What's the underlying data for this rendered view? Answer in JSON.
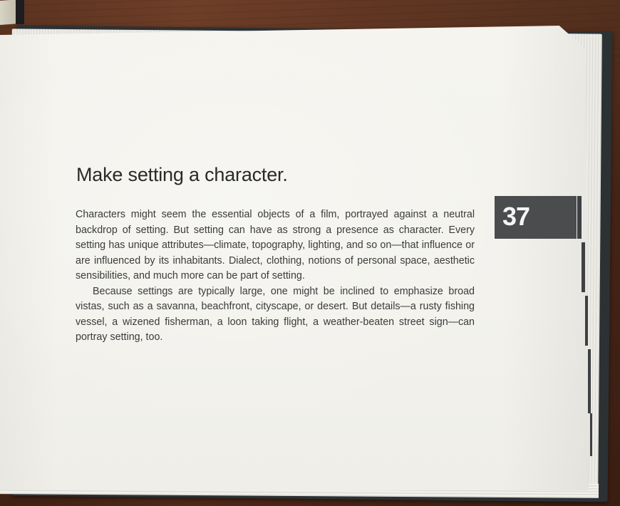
{
  "page": {
    "heading": "Make setting a character.",
    "page_number": "37",
    "paragraphs": [
      "Characters might seem the essential objects of a film, portrayed against a neutral backdrop of setting. But setting can have as strong a presence as character. Every setting has unique attributes—climate, topography, lighting, and so on—that influence or are influenced by its inhabitants. Dialect, clothing, notions of personal space, aesthetic sensibilities, and much more can be part of setting.",
      "Because settings are typically large, one might be inclined to emphasize broad vistas, such as a savanna, beachfront, cityscape, or desert. But details—a rusty fishing vessel, a wizened fisherman, a loon taking flight, a weather-beaten street sign—can portray setting, too."
    ]
  },
  "colors": {
    "page": "#f3f2ed",
    "text": "#3b3b3b",
    "tab": "#4a4c4e",
    "table": "#5a2f1d"
  }
}
